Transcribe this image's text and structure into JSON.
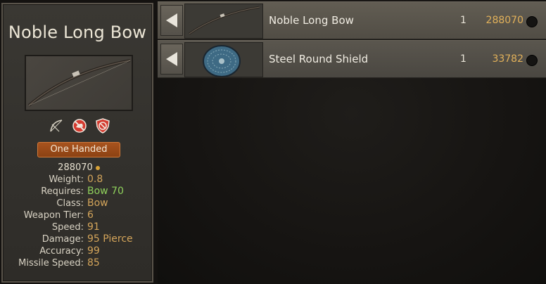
{
  "tooltip": {
    "title": "Noble Long Bow",
    "usage": "One Handed",
    "price": "288070",
    "flags": [
      "bow-icon",
      "no-mount-icon",
      "no-shield-icon"
    ],
    "stats": [
      {
        "label": "Weight:",
        "value": "0.8",
        "ok": false
      },
      {
        "label": "Requires:",
        "value": "Bow 70",
        "ok": true
      },
      {
        "label": "Class:",
        "value": "Bow",
        "ok": false
      },
      {
        "label": "Weapon Tier:",
        "value": "6",
        "ok": false
      },
      {
        "label": "Speed:",
        "value": "91",
        "ok": false
      },
      {
        "label": "Damage:",
        "value": "95 Pierce",
        "ok": false
      },
      {
        "label": "Accuracy:",
        "value": "99",
        "ok": false
      },
      {
        "label": "Missile Speed:",
        "value": "85",
        "ok": false
      }
    ]
  },
  "items": [
    {
      "name": "Noble Long Bow",
      "quantity": "1",
      "price": "288070",
      "thumbnail": "bow-thumbnail",
      "selected": true
    },
    {
      "name": "Steel Round Shield",
      "quantity": "1",
      "price": "33782",
      "thumbnail": "round-shield-thumbnail",
      "selected": false
    }
  ],
  "colors": {
    "value_text": "#d3a45a",
    "requirement_met": "#8fd15c",
    "usage_badge": "#a8531e",
    "price_text": "#e2b15a"
  }
}
